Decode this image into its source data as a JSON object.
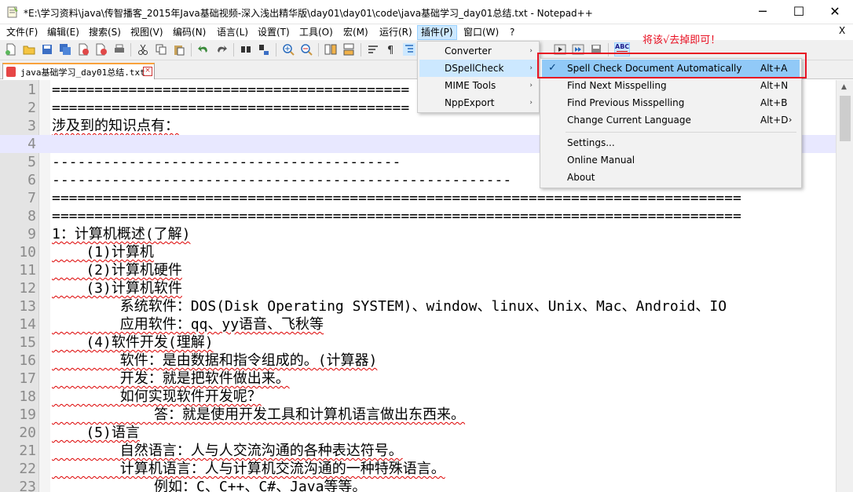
{
  "window": {
    "title": "*E:\\学习资料\\java\\传智播客_2015年Java基础视频-深入浅出精华版\\day01\\day01\\code\\java基础学习_day01总结.txt - Notepad++",
    "minimize_glyph": "─",
    "maximize_glyph": "☐",
    "close_glyph": "✕"
  },
  "menubar": {
    "items": [
      {
        "label": "文件(F)"
      },
      {
        "label": "编辑(E)"
      },
      {
        "label": "搜索(S)"
      },
      {
        "label": "视图(V)"
      },
      {
        "label": "编码(N)"
      },
      {
        "label": "语言(L)"
      },
      {
        "label": "设置(T)"
      },
      {
        "label": "工具(O)"
      },
      {
        "label": "宏(M)"
      },
      {
        "label": "运行(R)"
      },
      {
        "label": "插件(P)",
        "active": true
      },
      {
        "label": "窗口(W)"
      },
      {
        "label": "?"
      }
    ],
    "close_x": "X"
  },
  "tab": {
    "label": "java基础学习_day01总结.txt",
    "close_glyph": "×"
  },
  "editor": {
    "lines": [
      {
        "n": "1",
        "text": "=========================================="
      },
      {
        "n": "2",
        "text": "=========================================="
      },
      {
        "n": "3",
        "text": "涉及到的知识点有：",
        "squiggle": true
      },
      {
        "n": "4",
        "text": "",
        "current": true
      },
      {
        "n": "5",
        "text": "-----------------------------------------"
      },
      {
        "n": "6",
        "text": "------------------------------------------------------"
      },
      {
        "n": "7",
        "text": "================================================================================="
      },
      {
        "n": "8",
        "text": "================================================================================="
      },
      {
        "n": "9",
        "text": "1：计算机概述(了解)",
        "squiggle": true
      },
      {
        "n": "10",
        "text": "    (1)计算机",
        "squiggle": true
      },
      {
        "n": "11",
        "text": "    (2)计算机硬件",
        "squiggle": true
      },
      {
        "n": "12",
        "text": "    (3)计算机软件",
        "squiggle": true
      },
      {
        "n": "13",
        "text": "        系统软件：DOS(Disk Operating SYSTEM)、window、linux、Unix、Mac、Android、IO"
      },
      {
        "n": "14",
        "text": "        应用软件：qq、yy语音、飞秋等",
        "squiggle": true
      },
      {
        "n": "15",
        "text": "    (4)软件开发(理解)",
        "squiggle": true
      },
      {
        "n": "16",
        "text": "        软件：是由数据和指令组成的。(计算器)",
        "squiggle": true
      },
      {
        "n": "17",
        "text": "        开发：就是把软件做出来。",
        "squiggle": true
      },
      {
        "n": "18",
        "text": "        如何实现软件开发呢？",
        "squiggle": true
      },
      {
        "n": "19",
        "text": "            答：就是使用开发工具和计算机语言做出东西来。",
        "squiggle": true
      },
      {
        "n": "20",
        "text": "    (5)语言",
        "squiggle": true
      },
      {
        "n": "21",
        "text": "        自然语言：人与人交流沟通的各种表达符号。",
        "squiggle": true
      },
      {
        "n": "22",
        "text": "        计算机语言：人与计算机交流沟通的一种特殊语言。",
        "squiggle": true
      },
      {
        "n": "23",
        "text": "            例如：C、C++、C#、Java等等。"
      }
    ]
  },
  "plugins_menu": {
    "items": [
      {
        "label": "Converter"
      },
      {
        "label": "DSpellCheck",
        "hover": true
      },
      {
        "label": "MIME Tools"
      },
      {
        "label": "NppExport"
      }
    ],
    "arrow": "›"
  },
  "dspellcheck_menu": {
    "items": [
      {
        "label": "Spell Check Document Automatically",
        "shortcut": "Alt+A",
        "checked": true,
        "hover": true
      },
      {
        "label": "Find Next Misspelling",
        "shortcut": "Alt+N"
      },
      {
        "label": "Find Previous Misspelling",
        "shortcut": "Alt+B"
      },
      {
        "label": "Change Current Language",
        "shortcut": "Alt+D",
        "submenu": true
      },
      {
        "label": "Settings..."
      },
      {
        "label": "Online Manual"
      },
      {
        "label": "About"
      }
    ],
    "check_glyph": "✓",
    "arrow": "›"
  },
  "annotation": {
    "text": "将该√去掉即可！",
    "color": "#e81123"
  },
  "toolbar": {
    "icons": [
      "new-file-icon",
      "open-file-icon",
      "save-icon",
      "save-all-icon",
      "close-icon",
      "close-all-icon",
      "print-icon",
      "cut-icon",
      "copy-icon",
      "paste-icon",
      "undo-icon",
      "redo-icon",
      "find-icon",
      "replace-icon",
      "zoom-in-icon",
      "zoom-out-icon",
      "sync-v-icon",
      "sync-h-icon",
      "wrap-icon",
      "show-all-chars-icon",
      "indent-guide-icon",
      "record-macro-icon",
      "stop-macro-icon",
      "play-macro-icon",
      "run-macro-icon",
      "save-macro-icon",
      "spellcheck-icon"
    ],
    "spellcheck_label": "ABC"
  }
}
